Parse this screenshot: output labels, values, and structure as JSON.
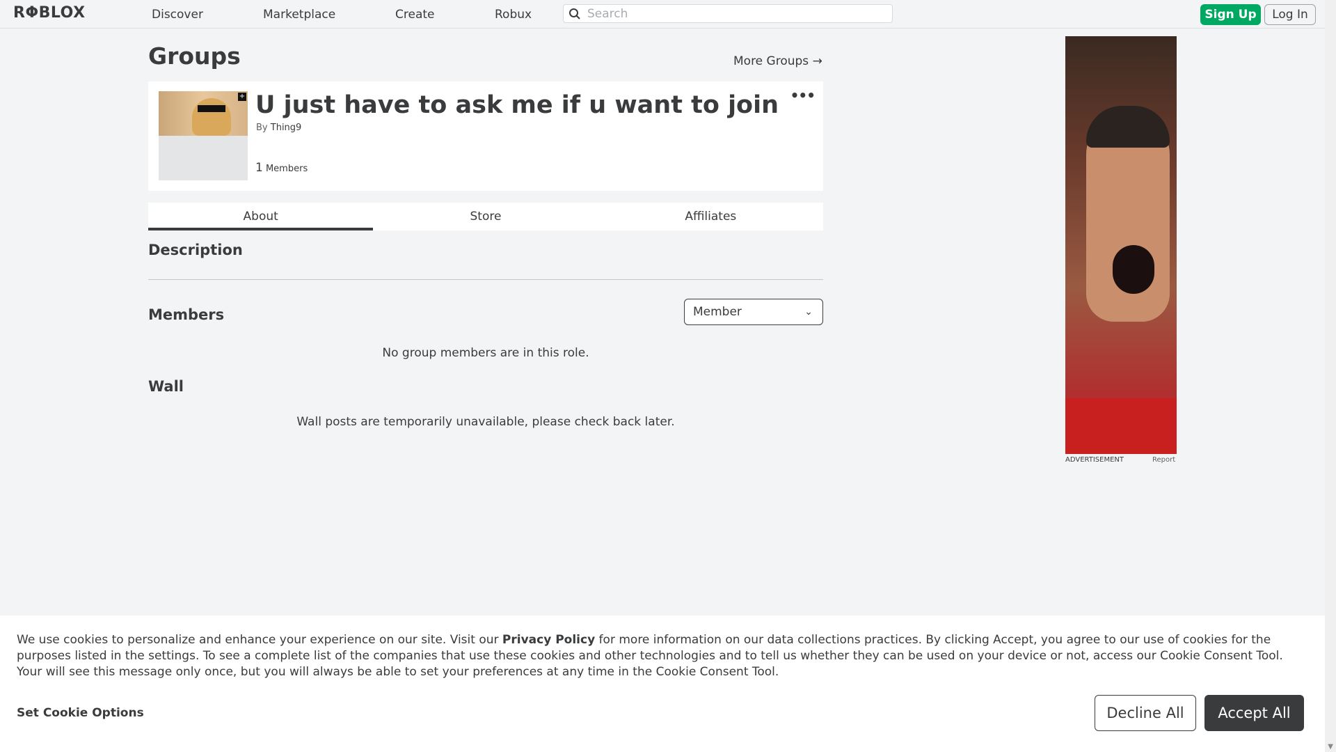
{
  "colors": {
    "accent_green": "#00a962",
    "text": "#393b3d",
    "background": "#f2f4f5"
  },
  "header": {
    "logo": "RΦBLOX",
    "nav": [
      "Discover",
      "Marketplace",
      "Create",
      "Robux"
    ],
    "search_placeholder": "Search",
    "signup_label": "Sign Up",
    "login_label": "Log In"
  },
  "page": {
    "title": "Groups",
    "more_groups": "More Groups →"
  },
  "group": {
    "name": "U just have to ask me if u want to join",
    "by_label": "By",
    "owner": "Thing9",
    "member_count": "1",
    "members_label": "Members",
    "more_menu": "•••"
  },
  "tabs": [
    "About",
    "Store",
    "Affiliates"
  ],
  "about": {
    "description_heading": "Description",
    "members_heading": "Members",
    "role_selected": "Member",
    "members_empty": "No group members are in this role.",
    "wall_heading": "Wall",
    "wall_message": "Wall posts are temporarily unavailable, please check back later."
  },
  "ad": {
    "label": "ADVERTISEMENT",
    "report": "Report"
  },
  "cookie": {
    "text_before": "We use cookies to personalize and enhance your experience on our site. Visit our ",
    "privacy_link": "Privacy Policy",
    "text_after": " for more information on our data collections practices. By clicking Accept, you agree to our use of cookies for the purposes listed in the settings. To see a complete list of the companies that use these cookies and other technologies and to tell us whether they can be used on your device or not, access our Cookie Consent Tool. Your will see this message only once, but you will always be able to set your preferences at any time in the Cookie Consent Tool.",
    "options_label": "Set Cookie Options",
    "decline_label": "Decline All",
    "accept_label": "Accept All"
  }
}
